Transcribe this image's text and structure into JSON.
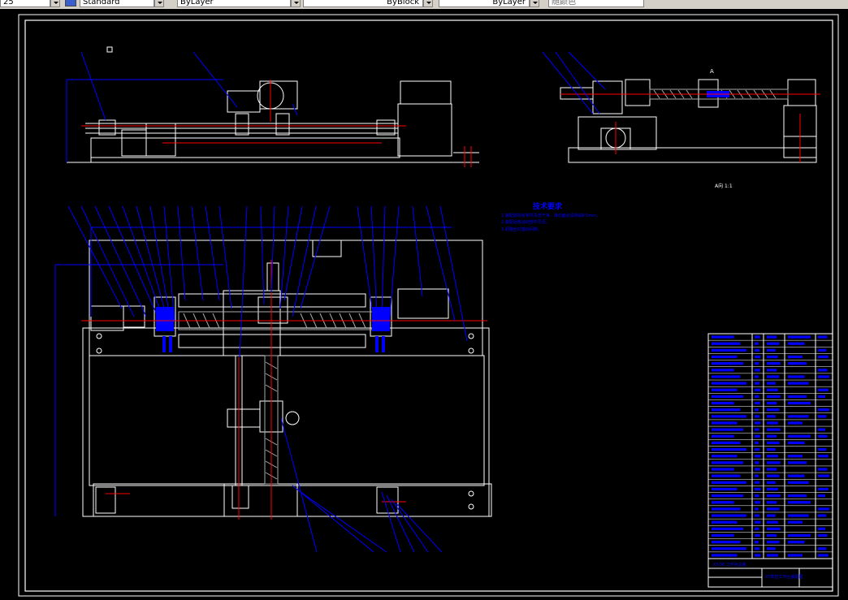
{
  "toolbar": {
    "scale_value": "25",
    "text_style": "Standard",
    "layer": "ByLayer",
    "linetype": "ByBlock",
    "lineweight": "ByLayer",
    "color": "随颜色"
  },
  "drawing": {
    "tech_title": "技术要求",
    "tech_notes": [
      "1.装配前所有零件清洗干净，滑动面涂润滑油Ⅱ-5mm。",
      "2.装配后各运动部件灵活。",
      "3.调整丝杠轴向间隙。"
    ],
    "view_label": "A",
    "view_caption": "A向 1:1",
    "title_block_left": "XY-00 工作台总装",
    "title_block_name": "XY数控工作台装配图"
  },
  "colors": {
    "background": "#000000",
    "geometry": "#ffffff",
    "annotation": "#0000ff",
    "centerline": "#ff0000"
  }
}
